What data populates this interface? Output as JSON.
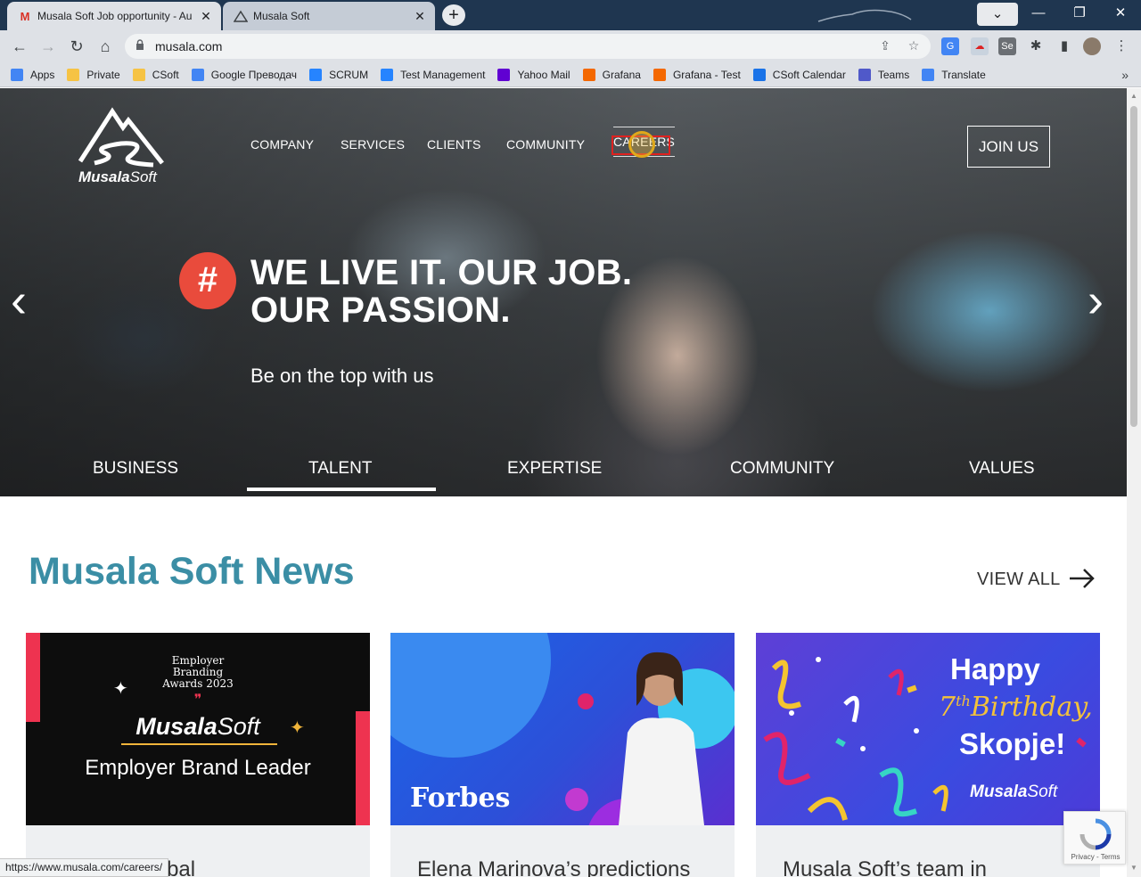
{
  "browser": {
    "tabs": [
      {
        "title": "Musala Soft Job opportunity - Au",
        "favicon": "gmail-icon",
        "active": true
      },
      {
        "title": "Musala Soft",
        "favicon": "musala-mountain-icon",
        "active": false
      }
    ],
    "new_tab_label": "+",
    "url": "musala.com",
    "bookmarks": [
      {
        "label": "Apps",
        "icon": "apps-grid-icon",
        "color": "#4285f4"
      },
      {
        "label": "Private",
        "icon": "folder-icon",
        "color": "#f6c344"
      },
      {
        "label": "CSoft",
        "icon": "folder-icon",
        "color": "#f6c344"
      },
      {
        "label": "Google Преводач",
        "icon": "translate-icon",
        "color": "#4285f4"
      },
      {
        "label": "SCRUM",
        "icon": "jira-icon",
        "color": "#2684ff"
      },
      {
        "label": "Test Management",
        "icon": "jira-icon",
        "color": "#2684ff"
      },
      {
        "label": "Yahoo Mail",
        "icon": "yahoo-icon",
        "color": "#6001d2"
      },
      {
        "label": "Grafana",
        "icon": "grafana-icon",
        "color": "#f46800"
      },
      {
        "label": "Grafana - Test",
        "icon": "grafana-icon",
        "color": "#f46800"
      },
      {
        "label": "CSoft Calendar",
        "icon": "calendar-icon",
        "color": "#1a73e8"
      },
      {
        "label": "Teams",
        "icon": "teams-icon",
        "color": "#5059c9"
      },
      {
        "label": "Translate",
        "icon": "translate-icon",
        "color": "#4285f4"
      }
    ],
    "status_url": "https://www.musala.com/careers/"
  },
  "site": {
    "logo_bold": "Musala",
    "logo_light": "Soft",
    "nav": [
      "COMPANY",
      "SERVICES",
      "CLIENTS",
      "COMMUNITY",
      "CAREERS"
    ],
    "join_label": "JOIN US",
    "hash": "#",
    "headline_1": "WE LIVE IT. OUR JOB.",
    "headline_2": "OUR PASSION.",
    "subline": "Be on the top with us",
    "slide_tabs": [
      "BUSINESS",
      "TALENT",
      "EXPERTISE",
      "COMMUNITY",
      "VALUES"
    ],
    "active_slide_tab": "TALENT",
    "news_title": "Musala Soft News",
    "view_all": "VIEW ALL",
    "cards": [
      {
        "title": "…n and Global",
        "img": {
          "award_line1": "Employer",
          "award_line2": "Branding",
          "award_line3": "Awards 2023",
          "quote": "❞",
          "brand_bold": "Musala",
          "brand_light": "Soft",
          "subtitle": "Employer Brand Leader"
        }
      },
      {
        "title": "Elena Marinova’s predictions",
        "img": {
          "brand": "Forbes"
        }
      },
      {
        "title": "Musala Soft’s team in",
        "img": {
          "line1": "Happy",
          "line2_num": "7",
          "line2_sup": "th",
          "line2_word": "Birthday,",
          "line3": "Skopje!",
          "brand_bold": "Musala",
          "brand_light": "Soft"
        }
      }
    ],
    "recaptcha_text": "Privacy - Terms"
  },
  "colors": {
    "accent_teal": "#3b8ea5",
    "hash_red": "#e94b3c",
    "chrome_tabbar": "#1f3650"
  }
}
